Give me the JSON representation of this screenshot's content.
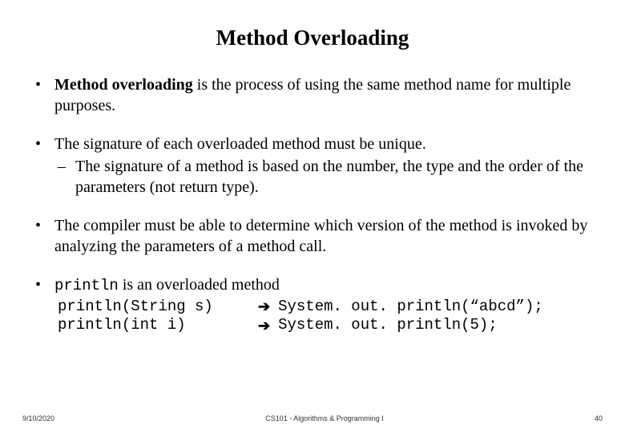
{
  "title": "Method Overloading",
  "bullets": {
    "b1": {
      "bold": "Method overloading",
      "rest": " is the process of using the same method name for multiple purposes."
    },
    "b2": {
      "text": "The signature of each overloaded method must be unique.",
      "sub": "The signature of a method is based on the number, the type and the order of the parameters (not return type)."
    },
    "b3": {
      "text": "The compiler must be able to determine which version of the method is invoked by analyzing the parameters of a method call."
    },
    "b4": {
      "code": "println",
      "rest": " is an overloaded method",
      "rows": [
        {
          "left": "println(String s)",
          "arrow": "➔",
          "right": "System. out. println(“abcd”);"
        },
        {
          "left": "println(int i)",
          "arrow": "➔",
          "right": "System. out. println(5);"
        }
      ]
    }
  },
  "footer": {
    "date": "9/10/2020",
    "course": "CS101 - Algorithms & Programming I",
    "page": "40"
  }
}
